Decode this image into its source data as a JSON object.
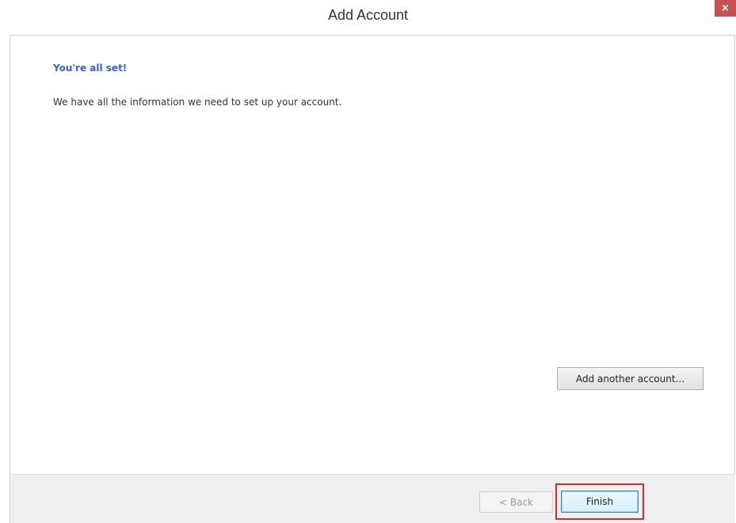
{
  "window": {
    "title": "Add Account",
    "close_label": "×"
  },
  "main": {
    "heading": "You're all set!",
    "message": "We have all the information we need to set up your account.",
    "add_another_label": "Add another account..."
  },
  "footer": {
    "back_label": "< Back",
    "finish_label": "Finish"
  },
  "colors": {
    "heading": "#3165c4",
    "close_button": "#c75050",
    "highlight": "#e3262e"
  }
}
